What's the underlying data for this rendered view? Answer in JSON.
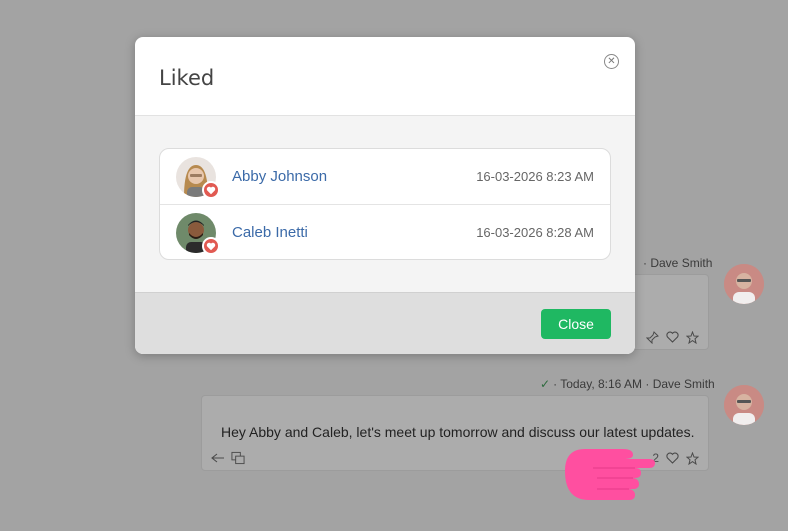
{
  "chat": {
    "message1": {
      "sender": "Dave Smith"
    },
    "message2": {
      "timestamp": "Today, 8:16 AM",
      "sender": "Dave Smith",
      "text": "Hey Abby and Caleb, let's meet up tomorrow and discuss our latest updates.",
      "like_count": "2"
    }
  },
  "modal": {
    "title": "Liked",
    "close_icon_glyph": "✕",
    "likers": [
      {
        "name": "Abby Johnson",
        "time": "16-03-2026 8:23 AM"
      },
      {
        "name": "Caleb Inetti",
        "time": "16-03-2026 8:28 AM"
      }
    ],
    "close_button_label": "Close"
  },
  "colors": {
    "accent_green": "#1fb862",
    "name_link": "#3b6aa8",
    "heart_badge": "#e15a52",
    "pointer_hand": "#ff4fa0"
  },
  "icons": [
    "close-icon",
    "heart-icon",
    "pin-icon",
    "star-icon",
    "reply-icon",
    "translate-icon",
    "check-icon",
    "pointer-hand-icon"
  ]
}
